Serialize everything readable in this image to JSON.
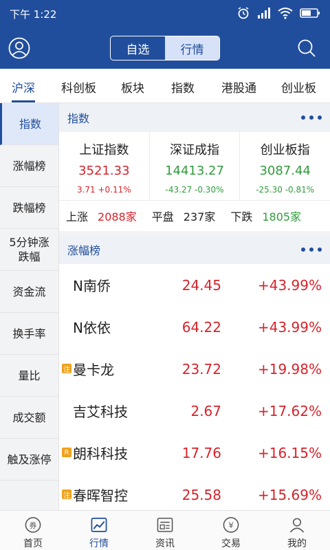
{
  "status_bar": {
    "time": "下午 1:22"
  },
  "header": {
    "segments": [
      {
        "label": "自选",
        "active": false
      },
      {
        "label": "行情",
        "active": true
      }
    ],
    "icons": [
      "avatar-icon",
      "search-icon"
    ]
  },
  "market_tabs": [
    {
      "label": "沪深",
      "active": true
    },
    {
      "label": "科创板",
      "active": false
    },
    {
      "label": "板块",
      "active": false
    },
    {
      "label": "指数",
      "active": false
    },
    {
      "label": "港股通",
      "active": false
    },
    {
      "label": "创业板",
      "active": false
    }
  ],
  "side_menu": [
    {
      "label": "指数",
      "active": true
    },
    {
      "label": "涨幅榜",
      "active": false
    },
    {
      "label": "跌幅榜",
      "active": false
    },
    {
      "label": "5分钟涨跌幅",
      "active": false
    },
    {
      "label": "资金流",
      "active": false
    },
    {
      "label": "换手率",
      "active": false
    },
    {
      "label": "量比",
      "active": false
    },
    {
      "label": "成交额",
      "active": false
    },
    {
      "label": "触及涨停",
      "active": false
    }
  ],
  "index_section": {
    "title": "指数",
    "indices": [
      {
        "name": "上证指数",
        "value": "3521.33",
        "change": "3.71 +0.11%",
        "trend": "up"
      },
      {
        "name": "深证成指",
        "value": "14413.27",
        "change": "-43.27 -0.30%",
        "trend": "down"
      },
      {
        "name": "创业板指",
        "value": "3087.44",
        "change": "-25.30 -0.81%",
        "trend": "down"
      }
    ],
    "breadth": {
      "up_label": "上涨",
      "up_count": "2088家",
      "flat_label": "平盘",
      "flat_count": "237家",
      "down_label": "下跌",
      "down_count": "1805家"
    }
  },
  "gainers_section": {
    "title": "涨幅榜",
    "rows": [
      {
        "tag": "",
        "name": "N南侨",
        "price": "24.45",
        "pct": "+43.99%"
      },
      {
        "tag": "",
        "name": "N依依",
        "price": "64.22",
        "pct": "+43.99%"
      },
      {
        "tag": "注",
        "name": "曼卡龙",
        "price": "23.72",
        "pct": "+19.98%"
      },
      {
        "tag": "",
        "name": "吉艾科技",
        "price": "2.67",
        "pct": "+17.62%"
      },
      {
        "tag": "R",
        "name": "朗科科技",
        "price": "17.76",
        "pct": "+16.15%"
      },
      {
        "tag": "注",
        "name": "春晖智控",
        "price": "25.58",
        "pct": "+15.69%"
      }
    ]
  },
  "bottom_tabs": [
    {
      "label": "首页",
      "icon": "coupon-icon",
      "active": false
    },
    {
      "label": "行情",
      "icon": "chart-icon",
      "active": true
    },
    {
      "label": "资讯",
      "icon": "news-icon",
      "active": false
    },
    {
      "label": "交易",
      "icon": "yen-icon",
      "active": false
    },
    {
      "label": "我的",
      "icon": "user-icon",
      "active": false
    }
  ],
  "colors": {
    "brand": "#214e9c",
    "up": "#d5232b",
    "down": "#2f9c3b"
  }
}
